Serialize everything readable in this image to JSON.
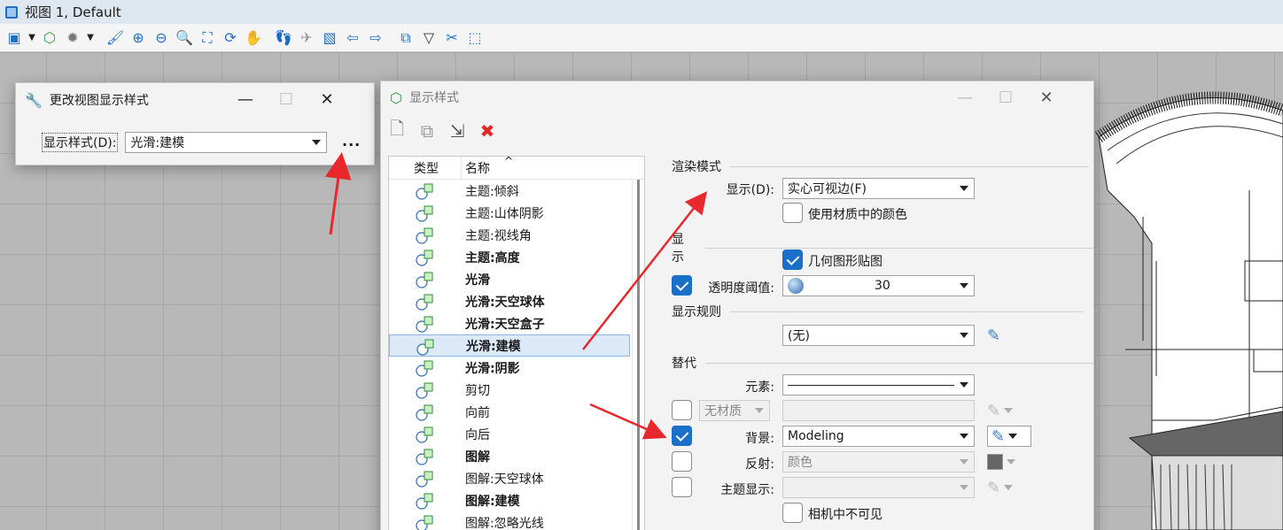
{
  "window": {
    "title": "视图 1, Default"
  },
  "toolbar": {
    "icons": [
      "view-attributes-icon",
      "display-style-icon",
      "lighting-icon",
      "brush-icon",
      "zoom-in-icon",
      "zoom-out-icon",
      "zoom-window-icon",
      "fit-view-icon",
      "rotate-view-icon",
      "pan-hand-icon",
      "walk-footprint-icon",
      "fly-icon",
      "camera-icon",
      "previous-view-icon",
      "next-view-icon",
      "copy-view-icon",
      "view-volume-icon",
      "clip-volume-icon",
      "clip-mask-icon"
    ]
  },
  "small_dialog": {
    "title": "更改视图显示样式",
    "style_label": "显示样式(D):",
    "style_value": "光滑:建模",
    "more_label": "..."
  },
  "main_dialog": {
    "title": "显示样式",
    "list": {
      "col_type": "类型",
      "col_name": "名称",
      "sort_caret": "^",
      "items": [
        {
          "name": "主题:倾斜",
          "bold": false
        },
        {
          "name": "主题:山体阴影",
          "bold": false
        },
        {
          "name": "主题:视线角",
          "bold": false
        },
        {
          "name": "主题:高度",
          "bold": true
        },
        {
          "name": "光滑",
          "bold": true
        },
        {
          "name": "光滑:天空球体",
          "bold": true
        },
        {
          "name": "光滑:天空盒子",
          "bold": true
        },
        {
          "name": "光滑:建模",
          "bold": true,
          "selected": true
        },
        {
          "name": "光滑:阴影",
          "bold": true
        },
        {
          "name": "剪切",
          "bold": false
        },
        {
          "name": "向前",
          "bold": false
        },
        {
          "name": "向后",
          "bold": false
        },
        {
          "name": "图解",
          "bold": true
        },
        {
          "name": "图解:天空球体",
          "bold": false
        },
        {
          "name": "图解:建模",
          "bold": true
        },
        {
          "name": "图解:忽略光线",
          "bold": false
        }
      ]
    },
    "render": {
      "section": "渲染模式",
      "display_label": "显示(D):",
      "display_value": "实心可视边(F)",
      "use_material_color": "使用材质中的颜色"
    },
    "display": {
      "section": "显示",
      "geometry_map": "几何图形贴图",
      "transparency_label": "透明度阈值:",
      "transparency_value": "30"
    },
    "rules": {
      "section": "显示规则",
      "value": "(无)"
    },
    "override": {
      "section": "替代",
      "element_label": "元素:",
      "material_value": "无材质",
      "background_label": "背景:",
      "background_value": "Modeling",
      "reflection_label": "反射:",
      "reflection_value": "颜色",
      "theme_label": "主题显示:",
      "invisible_in_camera": "相机中不可见"
    }
  },
  "colors": {
    "accent": "#1a6fc8",
    "arrow": "#e8282c",
    "grid": "#b8b8b8"
  }
}
